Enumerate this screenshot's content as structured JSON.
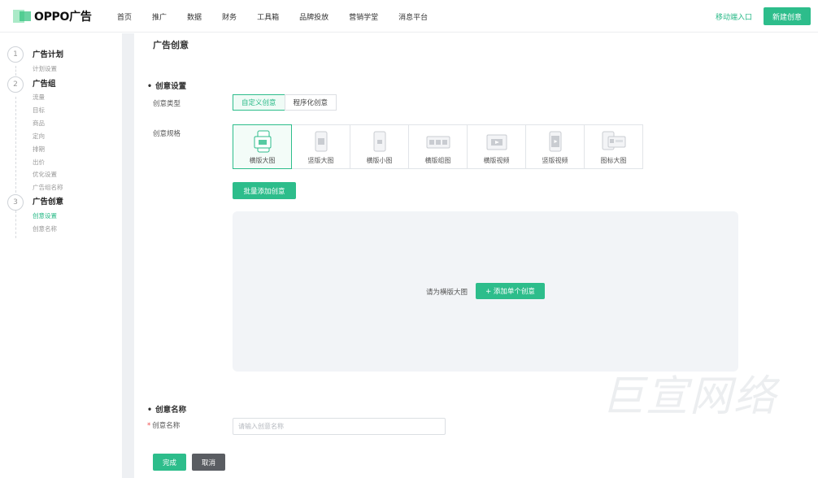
{
  "brand": {
    "logo_text": "OPPO广告",
    "accent": "#2dbd8b"
  },
  "nav": {
    "items": [
      "首页",
      "推广",
      "数据",
      "财务",
      "工具箱",
      "品牌投放",
      "营销学堂",
      "消息平台"
    ]
  },
  "header_actions": {
    "mobile_link": "移动端入口",
    "new_button": "新建创意"
  },
  "steps": [
    {
      "num": "1",
      "title": "广告计划",
      "subs": [
        "计划设置"
      ]
    },
    {
      "num": "2",
      "title": "广告组",
      "subs": [
        "流量",
        "目标",
        "商品",
        "定向",
        "排期",
        "出价",
        "优化设置",
        "广告组名称"
      ]
    },
    {
      "num": "3",
      "title": "广告创意",
      "subs": [
        "创意设置",
        "创意名称"
      ],
      "active_sub": "创意设置"
    }
  ],
  "page": {
    "title": "广告创意"
  },
  "creative_settings": {
    "section_title": "创意设置",
    "type_label": "创意类型",
    "types": [
      "自定义创意",
      "程序化创意"
    ],
    "active_type": "自定义创意",
    "spec_label": "创意规格",
    "specs": [
      "横版大图",
      "竖版大图",
      "横版小图",
      "横版组图",
      "横版视频",
      "竖版视频",
      "图标大图"
    ],
    "active_spec": "横版大图",
    "batch_button": "批量添加创意",
    "drop_hint": "请为横版大图",
    "add_single_button": "+ 添加单个创意"
  },
  "creative_name": {
    "section_title": "创意名称",
    "required_mark": "*",
    "field_label": "创意名称",
    "placeholder": "请输入创意名称",
    "value": ""
  },
  "actions": {
    "done": "完成",
    "cancel": "取消"
  },
  "watermark": "巨宣网络"
}
